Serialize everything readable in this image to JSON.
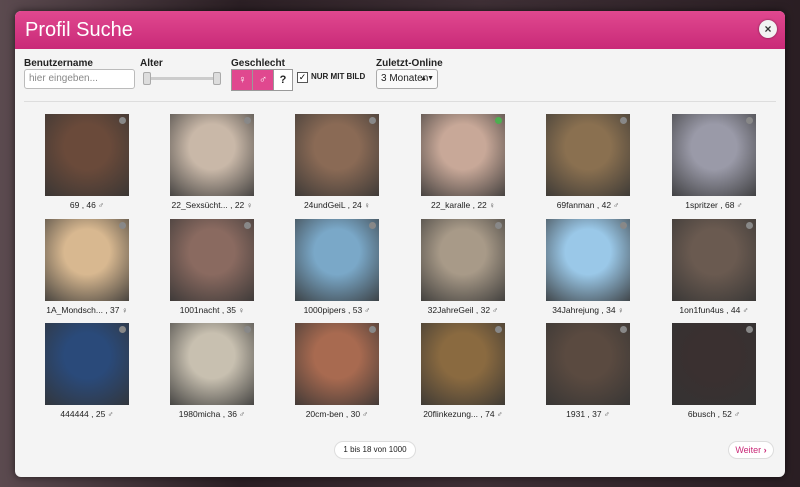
{
  "modal": {
    "title": "Profil Suche",
    "close_icon": "×"
  },
  "filters": {
    "username_label": "Benutzername",
    "username_placeholder": "hier eingeben...",
    "age_label": "Alter",
    "gender_label": "Geschlecht",
    "gender_options": [
      "female-icon",
      "male-icon",
      "?"
    ],
    "only_with_picture_label": "NUR MIT BILD",
    "only_with_picture_checked": true,
    "last_online_label": "Zuletzt-Online",
    "last_online_value": "3 Monaten"
  },
  "profiles": [
    {
      "name": "69",
      "age": "46",
      "gender": "male",
      "online": false,
      "color": "#6a4a3a"
    },
    {
      "name": "22_Sexsücht...",
      "age": "22",
      "gender": "female",
      "online": false,
      "color": "#c9b8a8"
    },
    {
      "name": "24undGeiL",
      "age": "24",
      "gender": "female",
      "online": false,
      "color": "#8a6a55"
    },
    {
      "name": "22_karalle",
      "age": "22",
      "gender": "female",
      "online": true,
      "color": "#c8a898"
    },
    {
      "name": "69fanman",
      "age": "42",
      "gender": "male",
      "online": false,
      "color": "#8a7050"
    },
    {
      "name": "1spritzer",
      "age": "68",
      "gender": "male",
      "online": false,
      "color": "#9a9aa8"
    },
    {
      "name": "1A_Mondsch...",
      "age": "37",
      "gender": "female",
      "online": false,
      "color": "#d8b890"
    },
    {
      "name": "1001nacht",
      "age": "35",
      "gender": "female",
      "online": false,
      "color": "#8a6a60"
    },
    {
      "name": "1000pipers",
      "age": "53",
      "gender": "male",
      "online": false,
      "color": "#7aa8c8"
    },
    {
      "name": "32JahreGeil",
      "age": "32",
      "gender": "male",
      "online": false,
      "color": "#a89a88"
    },
    {
      "name": "34Jahrejung",
      "age": "34",
      "gender": "female",
      "online": false,
      "color": "#9ac8e8"
    },
    {
      "name": "1on1fun4us",
      "age": "44",
      "gender": "male",
      "online": false,
      "color": "#6a5a50"
    },
    {
      "name": "444444",
      "age": "25",
      "gender": "male",
      "online": false,
      "color": "#2a4a7a"
    },
    {
      "name": "1980micha",
      "age": "36",
      "gender": "male",
      "online": false,
      "color": "#c8c0b0"
    },
    {
      "name": "20cm-ben",
      "age": "30",
      "gender": "male",
      "online": false,
      "color": "#a86a50"
    },
    {
      "name": "20flinkezung...",
      "age": "74",
      "gender": "male",
      "online": false,
      "color": "#8a6a40"
    },
    {
      "name": "1931",
      "age": "37",
      "gender": "male",
      "online": false,
      "color": "#5a4a40"
    },
    {
      "name": "6busch",
      "age": "52",
      "gender": "male",
      "online": false,
      "color": "#3a3030"
    }
  ],
  "pagination": {
    "summary": "1 bis 18 von 1000",
    "next_label": "Weiter"
  }
}
